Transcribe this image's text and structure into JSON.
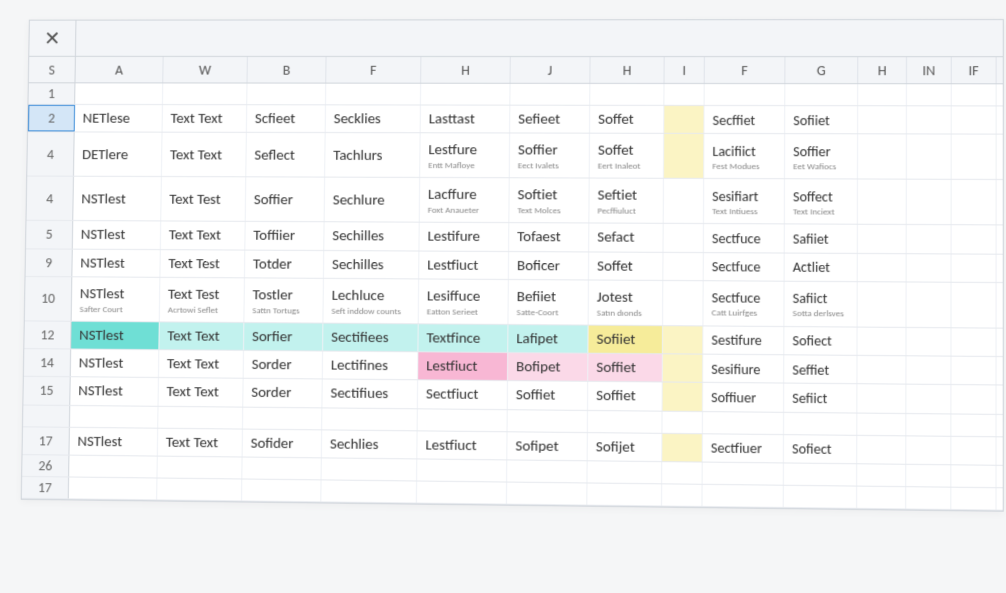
{
  "corner": {
    "close": "✕",
    "s": "S"
  },
  "cols": [
    "A",
    "W",
    "B",
    "F",
    "H",
    "J",
    "H",
    "I",
    "F",
    "G",
    "H",
    "IN",
    "IF"
  ],
  "rows": [
    {
      "h": "1",
      "cells": []
    },
    {
      "h": "2",
      "sel": true,
      "cells": [
        {
          "m": "NETlese"
        },
        {
          "m": "Text Text"
        },
        {
          "m": "Scfieet"
        },
        {
          "m": "Secklies"
        },
        {
          "m": "Lasttast"
        },
        {
          "m": "Sefieet"
        },
        {
          "m": "Soffet"
        },
        {
          "m": "",
          "hi": "y"
        },
        {
          "m": "Secffiet"
        },
        {
          "m": "Sofiiet"
        }
      ]
    },
    {
      "h": "4",
      "cells": [
        {
          "m": "DETlere"
        },
        {
          "m": "Text Text"
        },
        {
          "m": "Seflect"
        },
        {
          "m": "Tachlurs"
        },
        {
          "m": "Lestfure",
          "s": "Entt Mafloye"
        },
        {
          "m": "Soffier",
          "s": "Eect Ivalets"
        },
        {
          "m": "Soffet",
          "s": "Eert Inaleot"
        },
        {
          "m": "",
          "hi": "y"
        },
        {
          "m": "Lacifiict",
          "s": "Fest Modues"
        },
        {
          "m": "Soffier",
          "s": "Eet Wafiocs"
        }
      ]
    },
    {
      "h": "4",
      "cells": [
        {
          "m": "NSTlest"
        },
        {
          "m": "Text Test"
        },
        {
          "m": "Soffier"
        },
        {
          "m": "Sechlure"
        },
        {
          "m": "Lacffure",
          "s": "Foxt Anaueter"
        },
        {
          "m": "Softiet",
          "s": "Text Molces"
        },
        {
          "m": "Seftiet",
          "s": "Pecffiuluct"
        },
        {
          "m": ""
        },
        {
          "m": "Sesifiart",
          "s": "Text Intiuess"
        },
        {
          "m": "Soffect",
          "s": "Text Inciext"
        }
      ]
    },
    {
      "h": "5",
      "cells": [
        {
          "m": "NSTlest"
        },
        {
          "m": "Text Text"
        },
        {
          "m": "Toffiier"
        },
        {
          "m": "Sechilles"
        },
        {
          "m": "Lestifure"
        },
        {
          "m": "Tofaest"
        },
        {
          "m": "Sefact"
        },
        {
          "m": ""
        },
        {
          "m": "Sectfuce"
        },
        {
          "m": "Safiiet"
        }
      ]
    },
    {
      "h": "9",
      "cells": [
        {
          "m": "NSTlest"
        },
        {
          "m": "Text Test"
        },
        {
          "m": "Totder"
        },
        {
          "m": "Sechilles"
        },
        {
          "m": "Lestfiuct"
        },
        {
          "m": "Boficer"
        },
        {
          "m": "Soffet"
        },
        {
          "m": ""
        },
        {
          "m": "Sectfuce"
        },
        {
          "m": "Actliet"
        }
      ]
    },
    {
      "h": "10",
      "cells": [
        {
          "m": "NSTlest",
          "s": "Safter Court"
        },
        {
          "m": "Text Test",
          "s": "Acrtowi Seflet"
        },
        {
          "m": "Tostler",
          "s": "Sattn Tortugs"
        },
        {
          "m": "Lechluce",
          "s": "Seft inddow counts"
        },
        {
          "m": "Lesiffuce",
          "s": "Eatton Serieet"
        },
        {
          "m": "Befiiet",
          "s": "Satte-Coort"
        },
        {
          "m": "Jotest",
          "s": "Satın dıonds"
        },
        {
          "m": ""
        },
        {
          "m": "Sectfuce",
          "s": "Catt Luirfges"
        },
        {
          "m": "Safiict",
          "s": "Sotta derlsves"
        }
      ]
    },
    {
      "h": "12",
      "cells": [
        {
          "m": "NSTlest",
          "hi": "c"
        },
        {
          "m": "Text Text",
          "hi": "cl"
        },
        {
          "m": "Sorfier",
          "hi": "cl"
        },
        {
          "m": "Sectifiees",
          "hi": "cl"
        },
        {
          "m": "Textfince",
          "hi": "cl"
        },
        {
          "m": "Lafipet",
          "hi": "cl"
        },
        {
          "m": "Sofiiet",
          "hi": "yd"
        },
        {
          "m": "",
          "hi": "y"
        },
        {
          "m": "Sestifure"
        },
        {
          "m": "Sofiect"
        }
      ]
    },
    {
      "h": "14",
      "cells": [
        {
          "m": "NSTlest"
        },
        {
          "m": "Text Text"
        },
        {
          "m": "Sorder"
        },
        {
          "m": "Lectifines"
        },
        {
          "m": "Lestfiuct",
          "hi": "p"
        },
        {
          "m": "Bofipet",
          "hi": "pl"
        },
        {
          "m": "Soffiet",
          "hi": "pl"
        },
        {
          "m": "",
          "hi": "y"
        },
        {
          "m": "Sesifiure"
        },
        {
          "m": "Seffiet"
        }
      ]
    },
    {
      "h": "15",
      "cells": [
        {
          "m": "NSTlest"
        },
        {
          "m": "Text Text"
        },
        {
          "m": "Sorder"
        },
        {
          "m": "Sectifiues"
        },
        {
          "m": "Sectfiuct"
        },
        {
          "m": "Soffiet"
        },
        {
          "m": "Soffiet"
        },
        {
          "m": "",
          "hi": "y"
        },
        {
          "m": "Soffiuer"
        },
        {
          "m": "Sefiict"
        }
      ]
    },
    {
      "h": "",
      "cells": []
    },
    {
      "h": "17",
      "cells": [
        {
          "m": "NSTlest"
        },
        {
          "m": "Text Text"
        },
        {
          "m": "Sofider"
        },
        {
          "m": "Sechlies"
        },
        {
          "m": "Lestfiuct"
        },
        {
          "m": "Sofipet"
        },
        {
          "m": "Sofijet"
        },
        {
          "m": "",
          "hi": "y"
        },
        {
          "m": "Sectfiuer"
        },
        {
          "m": "Sofiect"
        }
      ]
    },
    {
      "h": "26",
      "cells": []
    },
    {
      "h": "17",
      "cells": []
    }
  ]
}
